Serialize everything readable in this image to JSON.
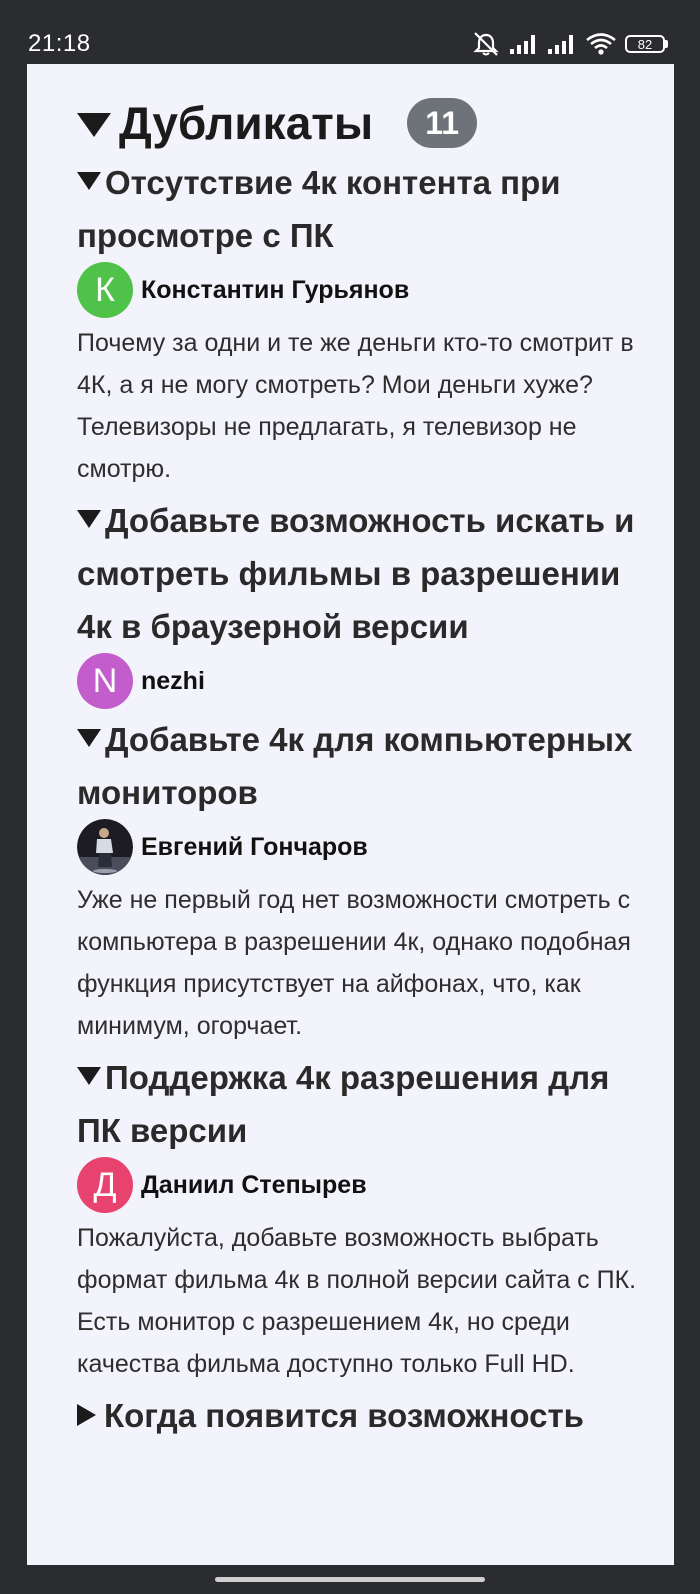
{
  "status_bar": {
    "time": "21:18",
    "battery": "82",
    "icons": [
      "alarm-off-icon",
      "signal-icon",
      "signal-icon",
      "wifi-icon",
      "battery-icon"
    ]
  },
  "group": {
    "title": "Дубликаты",
    "count": "11"
  },
  "items": [
    {
      "title": "Отсутствие 4к контента при просмотре с ПК",
      "author": "Константин Гурьянов",
      "avatar_letter": "К",
      "avatar_color": "#4fc24a",
      "text": "Почему за одни и те же деньги кто-то смотрит в 4К, а я не могу смотреть? Мои деньги хуже? Телевизоры не предлагать, я телевизор не смотрю."
    },
    {
      "title": "Добавьте возможность искать и смотреть фильмы в разрешении 4к в браузерной версии",
      "author": "nezhi",
      "avatar_letter": "N",
      "avatar_color": "#c25dcb"
    },
    {
      "title": "Добавьте 4к для компьютерных мониторов",
      "author": "Евгений Гончаров",
      "avatar_kind": "photo",
      "text": "Уже не первый год нет возможности смотреть с компьютера в разрешении 4к, однако подобная функция присутствует на айфонах, что, как минимум, огорчает."
    },
    {
      "title": "Поддержка 4к разрешения для ПК версии",
      "author": "Даниил Степырев",
      "avatar_letter": "Д",
      "avatar_color": "#e8436e",
      "text": "Пожалуйста, добавьте возможность выбрать формат фильма 4к в полной версии сайта с ПК. Есть монитор с разрешением 4к, но среди качества фильма доступно только Full HD."
    },
    {
      "title": "Когда появится возможность"
    }
  ]
}
